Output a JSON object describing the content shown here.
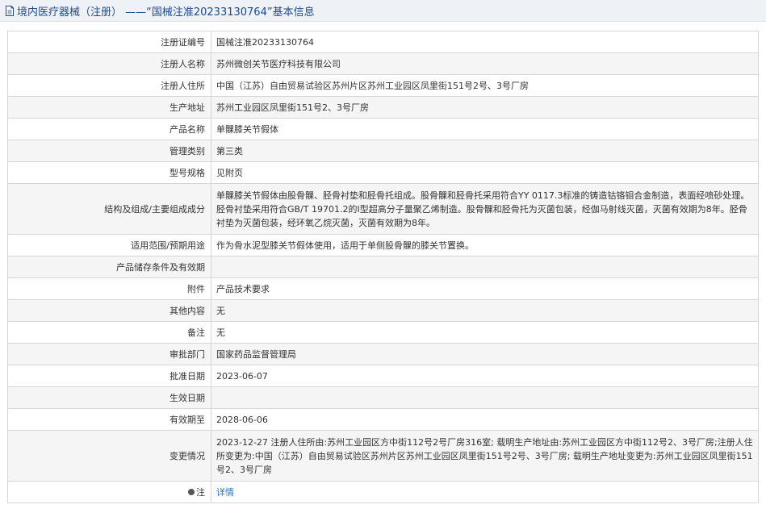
{
  "header": {
    "title": "境内医疗器械（注册） ——“国械注准20233130764”基本信息"
  },
  "rows": [
    {
      "label": "注册证编号",
      "value": "国械注准20233130764"
    },
    {
      "label": "注册人名称",
      "value": "苏州微创关节医疗科技有限公司"
    },
    {
      "label": "注册人住所",
      "value": "中国（江苏）自由贸易试验区苏州片区苏州工业园区凤里街151号2号、3号厂房"
    },
    {
      "label": "生产地址",
      "value": "苏州工业园区凤里街151号2、3号厂房"
    },
    {
      "label": "产品名称",
      "value": "单髁膝关节假体"
    },
    {
      "label": "管理类别",
      "value": "第三类"
    },
    {
      "label": "型号规格",
      "value": "见附页"
    },
    {
      "label": "结构及组成/主要组成成分",
      "value": "单髁膝关节假体由股骨髁、胫骨衬垫和胫骨托组成。股骨髁和胫骨托采用符合YY 0117.3标准的铸造钴铬钼合金制造，表面经喷砂处理。胫骨衬垫采用符合GB/T 19701.2的I型超高分子量聚乙烯制造。股骨髁和胫骨托为灭菌包装，经伽马射线灭菌，灭菌有效期为8年。胫骨衬垫为灭菌包装，经环氧乙烷灭菌，灭菌有效期为8年。"
    },
    {
      "label": "适用范围/预期用途",
      "value": "作为骨水泥型膝关节假体使用，适用于单侧股骨髁的膝关节置换。"
    },
    {
      "label": "产品储存条件及有效期",
      "value": ""
    },
    {
      "label": "附件",
      "value": "产品技术要求"
    },
    {
      "label": "其他内容",
      "value": "无"
    },
    {
      "label": "备注",
      "value": "无"
    },
    {
      "label": "审批部门",
      "value": "国家药品监督管理局"
    },
    {
      "label": "批准日期",
      "value": "2023-06-07"
    },
    {
      "label": "生效日期",
      "value": ""
    },
    {
      "label": "有效期至",
      "value": "2028-06-06"
    },
    {
      "label": "变更情况",
      "value": "2023-12-27 注册人住所由:苏州工业园区方中街112号2号厂房316室; 载明生产地址由:苏州工业园区方中街112号2、3号厂房;注册人住所变更为:中国（江苏）自由贸易试验区苏州片区苏州工业园区凤里街151号2号、3号厂房; 载明生产地址变更为:苏州工业园区凤里街151号2、3号厂房"
    }
  ],
  "note": {
    "label": "注",
    "link_text": "详情"
  }
}
